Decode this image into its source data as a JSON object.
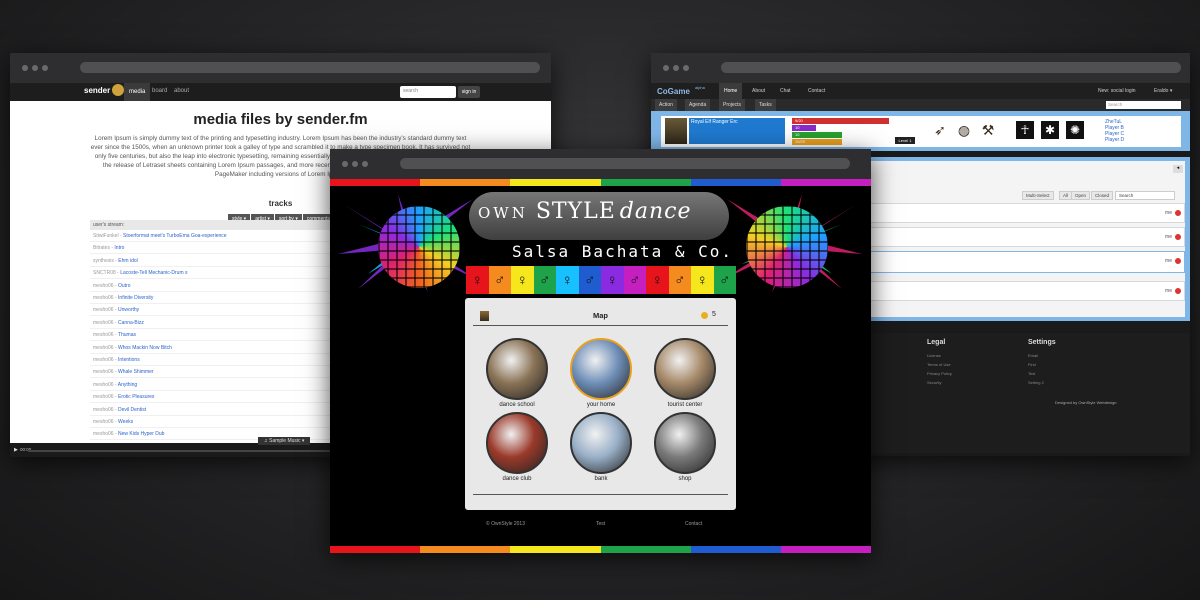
{
  "left_window": {
    "logo": "sender",
    "logo_sub": "fm",
    "nav": [
      "media",
      "board",
      "about"
    ],
    "search_placeholder": "search",
    "sign_label": "sign in",
    "title": "media files by sender.fm",
    "lorem": "Lorem Ipsum is simply dummy text of the printing and typesetting industry. Lorem Ipsum has been the industry's standard dummy text ever since the 1500s, when an unknown printer took a galley of type and scrambled it to make a type specimen book. It has survived not only five centuries, but also the leap into electronic typesetting, remaining essentially unchanged. It was popularised in the 1960s with the release of Letraset sheets containing Lorem Ipsum passages, and more recently with desktop publishing software like Aldus PageMaker including versions of Lorem Ipsum.",
    "tracks_title": "tracks",
    "filters": [
      "style ▾",
      "artist ▾",
      "sort by ▾",
      "comments"
    ],
    "stream_head": "user's stream:",
    "tracks": [
      {
        "user": "StiwiFunkel",
        "title": "Stoerformat meet's TurboEma Goa-experience"
      },
      {
        "user": "Bitrates",
        "title": "Intro"
      },
      {
        "user": "synthesis",
        "title": "Ehm idol"
      },
      {
        "user": "SNCTR08",
        "title": "Lacoste-Tell Mechanic-Drum s"
      },
      {
        "user": "mesho06",
        "title": "Outro"
      },
      {
        "user": "mesho06",
        "title": "Infinite Diversity"
      },
      {
        "user": "mesho06",
        "title": "Unworthy"
      },
      {
        "user": "mesho06",
        "title": "Canna-Bizz"
      },
      {
        "user": "mesho06",
        "title": "Thumas"
      },
      {
        "user": "mesho06",
        "title": "Whos Mackin Now Bitch"
      },
      {
        "user": "mesho06",
        "title": "Intentions"
      },
      {
        "user": "mesho06",
        "title": "Whale Shimmer"
      },
      {
        "user": "mesho06",
        "title": "Anything"
      },
      {
        "user": "mesho06",
        "title": "Erotic Pleasures"
      },
      {
        "user": "mesho06",
        "title": "Devil Dentist"
      },
      {
        "user": "mesho06",
        "title": "Weeks"
      },
      {
        "user": "mesho06",
        "title": "New Kids Hyper Dub"
      }
    ],
    "sample_music": "♫ Sample Music ▾",
    "time": "00:00"
  },
  "right_window": {
    "brand": "CoGame",
    "brand_sup": "alpha",
    "nav": [
      "Home",
      "About",
      "Chat",
      "Contact"
    ],
    "new_login": "New: social login",
    "user": "Eraldo ▾",
    "subnav": [
      "Action",
      "Agenda",
      "Projects",
      "Tasks"
    ],
    "search_placeholder": "Search",
    "player_name": "Royal Elf Ranger Erc",
    "stats": [
      "9/20",
      "10",
      "10",
      "10/20"
    ],
    "level": "Level 1",
    "players": [
      "ZheTuL",
      "Player B",
      "Player C",
      "Player D"
    ],
    "filter_tabs": [
      "Multi-Select",
      "All",
      "Open",
      "Closed"
    ],
    "filter_search": "Search",
    "me_label": "me",
    "footer": {
      "legal_title": "Legal",
      "legal_links": [
        "License",
        "Terms of Use",
        "Privacy Policy",
        "Security"
      ],
      "settings_title": "Settings",
      "settings_links": [
        "Email",
        "Find",
        "Test",
        "Setting 2"
      ],
      "designed": "Designed by OwnStyle Webdesign"
    }
  },
  "center_window": {
    "brand_own": "OWN",
    "brand_style": "STYLE",
    "brand_dance": "dance",
    "tagline": "Salsa Bachata & Co.",
    "map_title": "Map",
    "coins": "5",
    "places": [
      {
        "label": "dance school",
        "color": "#8a7356"
      },
      {
        "label": "your home",
        "color": "#6f8fb8"
      },
      {
        "label": "tourist center",
        "color": "#a68a6a"
      },
      {
        "label": "dance club",
        "color": "#9a3a2a"
      },
      {
        "label": "bank",
        "color": "#9ab0c8"
      },
      {
        "label": "shop",
        "color": "#7a7a7a"
      }
    ],
    "footer": [
      "© OwnStyle 2013",
      "Test",
      "Contact"
    ]
  },
  "rainbow": [
    "#e8141c",
    "#f58a1f",
    "#f6e61c",
    "#1fa34a",
    "#1f5ccf",
    "#c61fbf"
  ]
}
